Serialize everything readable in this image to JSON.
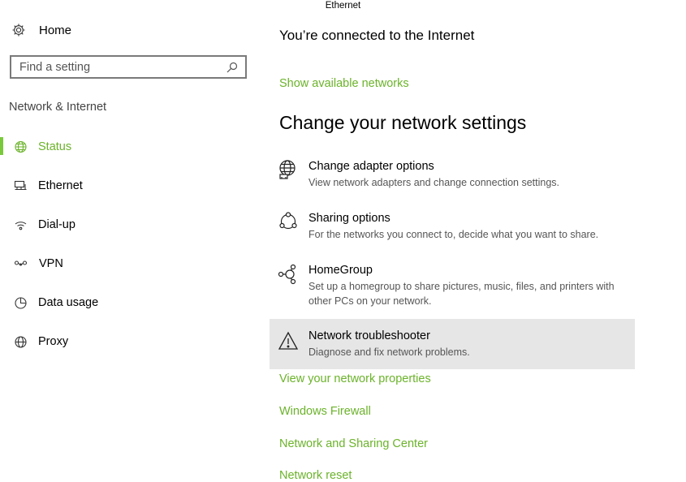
{
  "window": {
    "title": "Ethernet"
  },
  "sidebar": {
    "home_label": "Home",
    "search": {
      "placeholder": "Find a setting"
    },
    "section_label": "Network & Internet",
    "items": [
      {
        "label": "Status",
        "icon": "globe-status-icon",
        "active": true
      },
      {
        "label": "Ethernet",
        "icon": "ethernet-icon",
        "active": false
      },
      {
        "label": "Dial-up",
        "icon": "dialup-icon",
        "active": false
      },
      {
        "label": "VPN",
        "icon": "vpn-icon",
        "active": false
      },
      {
        "label": "Data usage",
        "icon": "pie-chart-icon",
        "active": false
      },
      {
        "label": "Proxy",
        "icon": "globe-icon",
        "active": false
      }
    ]
  },
  "main": {
    "connection_status": "You’re connected to the Internet",
    "show_networks_link": "Show available networks",
    "heading": "Change your network settings",
    "options": [
      {
        "title": "Change adapter options",
        "desc": "View network adapters and change connection settings.",
        "icon": "adapter-globe-icon"
      },
      {
        "title": "Sharing options",
        "desc": "For the networks you connect to, decide what you want to share.",
        "icon": "sharing-icon"
      },
      {
        "title": "HomeGroup",
        "desc": "Set up a homegroup to share pictures, music, files, and printers with other PCs on your network.",
        "icon": "homegroup-icon"
      },
      {
        "title": "Network troubleshooter",
        "desc": "Diagnose and fix network problems.",
        "icon": "warning-icon"
      }
    ],
    "links": [
      "View your network properties",
      "Windows Firewall",
      "Network and Sharing Center",
      "Network reset"
    ]
  },
  "colors": {
    "accent": "#6bb32a",
    "highlight": "#e6e6e6"
  }
}
